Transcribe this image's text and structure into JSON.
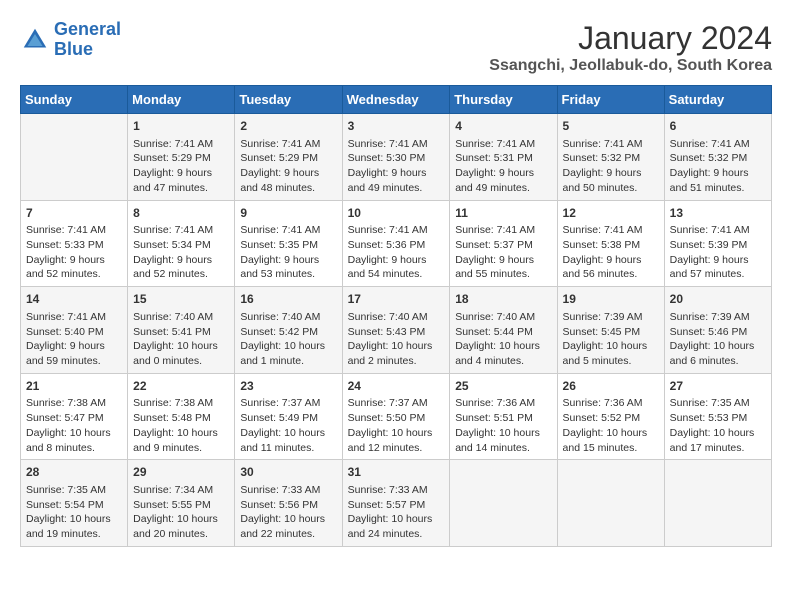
{
  "header": {
    "logo_line1": "General",
    "logo_line2": "Blue",
    "title": "January 2024",
    "subtitle": "Ssangchi, Jeollabuk-do, South Korea"
  },
  "days_of_week": [
    "Sunday",
    "Monday",
    "Tuesday",
    "Wednesday",
    "Thursday",
    "Friday",
    "Saturday"
  ],
  "weeks": [
    [
      {
        "day": "",
        "sunrise": "",
        "sunset": "",
        "daylight": ""
      },
      {
        "day": "1",
        "sunrise": "Sunrise: 7:41 AM",
        "sunset": "Sunset: 5:29 PM",
        "daylight": "Daylight: 9 hours and 47 minutes."
      },
      {
        "day": "2",
        "sunrise": "Sunrise: 7:41 AM",
        "sunset": "Sunset: 5:29 PM",
        "daylight": "Daylight: 9 hours and 48 minutes."
      },
      {
        "day": "3",
        "sunrise": "Sunrise: 7:41 AM",
        "sunset": "Sunset: 5:30 PM",
        "daylight": "Daylight: 9 hours and 49 minutes."
      },
      {
        "day": "4",
        "sunrise": "Sunrise: 7:41 AM",
        "sunset": "Sunset: 5:31 PM",
        "daylight": "Daylight: 9 hours and 49 minutes."
      },
      {
        "day": "5",
        "sunrise": "Sunrise: 7:41 AM",
        "sunset": "Sunset: 5:32 PM",
        "daylight": "Daylight: 9 hours and 50 minutes."
      },
      {
        "day": "6",
        "sunrise": "Sunrise: 7:41 AM",
        "sunset": "Sunset: 5:32 PM",
        "daylight": "Daylight: 9 hours and 51 minutes."
      }
    ],
    [
      {
        "day": "7",
        "sunrise": "Sunrise: 7:41 AM",
        "sunset": "Sunset: 5:33 PM",
        "daylight": "Daylight: 9 hours and 52 minutes."
      },
      {
        "day": "8",
        "sunrise": "Sunrise: 7:41 AM",
        "sunset": "Sunset: 5:34 PM",
        "daylight": "Daylight: 9 hours and 52 minutes."
      },
      {
        "day": "9",
        "sunrise": "Sunrise: 7:41 AM",
        "sunset": "Sunset: 5:35 PM",
        "daylight": "Daylight: 9 hours and 53 minutes."
      },
      {
        "day": "10",
        "sunrise": "Sunrise: 7:41 AM",
        "sunset": "Sunset: 5:36 PM",
        "daylight": "Daylight: 9 hours and 54 minutes."
      },
      {
        "day": "11",
        "sunrise": "Sunrise: 7:41 AM",
        "sunset": "Sunset: 5:37 PM",
        "daylight": "Daylight: 9 hours and 55 minutes."
      },
      {
        "day": "12",
        "sunrise": "Sunrise: 7:41 AM",
        "sunset": "Sunset: 5:38 PM",
        "daylight": "Daylight: 9 hours and 56 minutes."
      },
      {
        "day": "13",
        "sunrise": "Sunrise: 7:41 AM",
        "sunset": "Sunset: 5:39 PM",
        "daylight": "Daylight: 9 hours and 57 minutes."
      }
    ],
    [
      {
        "day": "14",
        "sunrise": "Sunrise: 7:41 AM",
        "sunset": "Sunset: 5:40 PM",
        "daylight": "Daylight: 9 hours and 59 minutes."
      },
      {
        "day": "15",
        "sunrise": "Sunrise: 7:40 AM",
        "sunset": "Sunset: 5:41 PM",
        "daylight": "Daylight: 10 hours and 0 minutes."
      },
      {
        "day": "16",
        "sunrise": "Sunrise: 7:40 AM",
        "sunset": "Sunset: 5:42 PM",
        "daylight": "Daylight: 10 hours and 1 minute."
      },
      {
        "day": "17",
        "sunrise": "Sunrise: 7:40 AM",
        "sunset": "Sunset: 5:43 PM",
        "daylight": "Daylight: 10 hours and 2 minutes."
      },
      {
        "day": "18",
        "sunrise": "Sunrise: 7:40 AM",
        "sunset": "Sunset: 5:44 PM",
        "daylight": "Daylight: 10 hours and 4 minutes."
      },
      {
        "day": "19",
        "sunrise": "Sunrise: 7:39 AM",
        "sunset": "Sunset: 5:45 PM",
        "daylight": "Daylight: 10 hours and 5 minutes."
      },
      {
        "day": "20",
        "sunrise": "Sunrise: 7:39 AM",
        "sunset": "Sunset: 5:46 PM",
        "daylight": "Daylight: 10 hours and 6 minutes."
      }
    ],
    [
      {
        "day": "21",
        "sunrise": "Sunrise: 7:38 AM",
        "sunset": "Sunset: 5:47 PM",
        "daylight": "Daylight: 10 hours and 8 minutes."
      },
      {
        "day": "22",
        "sunrise": "Sunrise: 7:38 AM",
        "sunset": "Sunset: 5:48 PM",
        "daylight": "Daylight: 10 hours and 9 minutes."
      },
      {
        "day": "23",
        "sunrise": "Sunrise: 7:37 AM",
        "sunset": "Sunset: 5:49 PM",
        "daylight": "Daylight: 10 hours and 11 minutes."
      },
      {
        "day": "24",
        "sunrise": "Sunrise: 7:37 AM",
        "sunset": "Sunset: 5:50 PM",
        "daylight": "Daylight: 10 hours and 12 minutes."
      },
      {
        "day": "25",
        "sunrise": "Sunrise: 7:36 AM",
        "sunset": "Sunset: 5:51 PM",
        "daylight": "Daylight: 10 hours and 14 minutes."
      },
      {
        "day": "26",
        "sunrise": "Sunrise: 7:36 AM",
        "sunset": "Sunset: 5:52 PM",
        "daylight": "Daylight: 10 hours and 15 minutes."
      },
      {
        "day": "27",
        "sunrise": "Sunrise: 7:35 AM",
        "sunset": "Sunset: 5:53 PM",
        "daylight": "Daylight: 10 hours and 17 minutes."
      }
    ],
    [
      {
        "day": "28",
        "sunrise": "Sunrise: 7:35 AM",
        "sunset": "Sunset: 5:54 PM",
        "daylight": "Daylight: 10 hours and 19 minutes."
      },
      {
        "day": "29",
        "sunrise": "Sunrise: 7:34 AM",
        "sunset": "Sunset: 5:55 PM",
        "daylight": "Daylight: 10 hours and 20 minutes."
      },
      {
        "day": "30",
        "sunrise": "Sunrise: 7:33 AM",
        "sunset": "Sunset: 5:56 PM",
        "daylight": "Daylight: 10 hours and 22 minutes."
      },
      {
        "day": "31",
        "sunrise": "Sunrise: 7:33 AM",
        "sunset": "Sunset: 5:57 PM",
        "daylight": "Daylight: 10 hours and 24 minutes."
      },
      {
        "day": "",
        "sunrise": "",
        "sunset": "",
        "daylight": ""
      },
      {
        "day": "",
        "sunrise": "",
        "sunset": "",
        "daylight": ""
      },
      {
        "day": "",
        "sunrise": "",
        "sunset": "",
        "daylight": ""
      }
    ]
  ]
}
